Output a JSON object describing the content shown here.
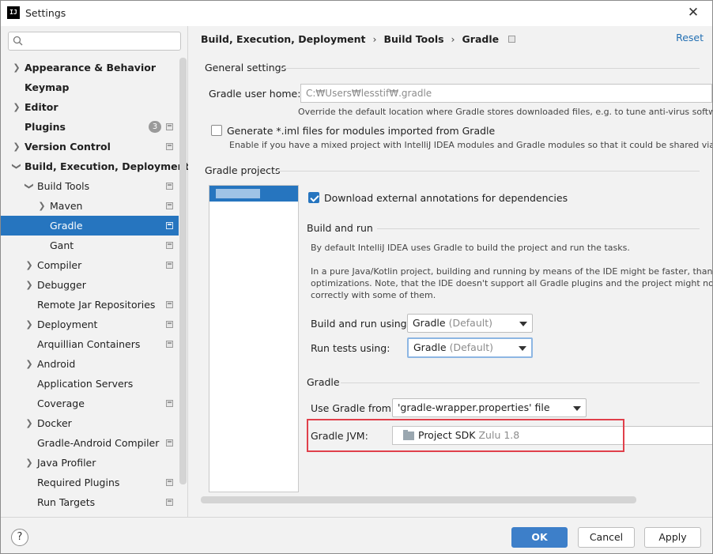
{
  "window": {
    "title": "Settings",
    "app_icon_text": "IJ"
  },
  "sidebar": {
    "search": {
      "value": "",
      "placeholder": ""
    },
    "items": [
      {
        "label": "Appearance & Behavior"
      },
      {
        "label": "Keymap"
      },
      {
        "label": "Editor"
      },
      {
        "label": "Plugins",
        "badge": "3"
      },
      {
        "label": "Version Control"
      },
      {
        "label": "Build, Execution, Deployment"
      },
      {
        "label": "Build Tools"
      },
      {
        "label": "Maven"
      },
      {
        "label": "Gradle"
      },
      {
        "label": "Gant"
      },
      {
        "label": "Compiler"
      },
      {
        "label": "Debugger"
      },
      {
        "label": "Remote Jar Repositories"
      },
      {
        "label": "Deployment"
      },
      {
        "label": "Arquillian Containers"
      },
      {
        "label": "Android"
      },
      {
        "label": "Application Servers"
      },
      {
        "label": "Coverage"
      },
      {
        "label": "Docker"
      },
      {
        "label": "Gradle-Android Compiler"
      },
      {
        "label": "Java Profiler"
      },
      {
        "label": "Required Plugins"
      },
      {
        "label": "Run Targets"
      }
    ]
  },
  "header": {
    "breadcrumb": [
      "Build, Execution, Deployment",
      "Build Tools",
      "Gradle"
    ],
    "separator": "›",
    "reset_label": "Reset"
  },
  "general": {
    "title": "General settings",
    "user_home_label": "Gradle user home:",
    "user_home_value": "C:₩Users₩lesstif₩.gradle",
    "user_home_hint": "Override the default location where Gradle stores downloaded files, e.g. to tune anti-virus software",
    "generate_iml_label": "Generate *.iml files for modules imported from Gradle",
    "generate_iml_hint": "Enable if you have a mixed project with IntelliJ IDEA modules and Gradle modules so that it could be shared via VC"
  },
  "projects": {
    "title": "Gradle projects",
    "download_annotations_label": "Download external annotations for dependencies"
  },
  "build_and_run": {
    "title": "Build and run",
    "desc1": "By default IntelliJ IDEA uses Gradle to build the project and run the tasks.",
    "desc2_line1": "In a pure Java/Kotlin project, building and running by means of the IDE might be faster, thanks t",
    "desc2_line2": "optimizations. Note, that the IDE doesn't support all Gradle plugins and the project might not b",
    "desc2_line3": "correctly with some of them.",
    "build_run_using_label": "Build and run using:",
    "build_run_using_value": "Gradle",
    "build_run_using_default": "(Default)",
    "run_tests_using_label": "Run tests using:",
    "run_tests_using_value": "Gradle",
    "run_tests_using_default": "(Default)"
  },
  "gradle": {
    "title": "Gradle",
    "use_gradle_from_label": "Use Gradle from:",
    "use_gradle_from_value": "'gradle-wrapper.properties' file",
    "jvm_label": "Gradle JVM:",
    "jvm_value": "Project SDK",
    "jvm_version": "Zulu 1.8"
  },
  "footer": {
    "help_label": "?",
    "ok_label": "OK",
    "cancel_label": "Cancel",
    "apply_label": "Apply"
  },
  "colors": {
    "selection": "#2675bf",
    "accent_link": "#2470b3",
    "highlight_border": "#e0404b",
    "primary_button": "#3d7fc9"
  }
}
